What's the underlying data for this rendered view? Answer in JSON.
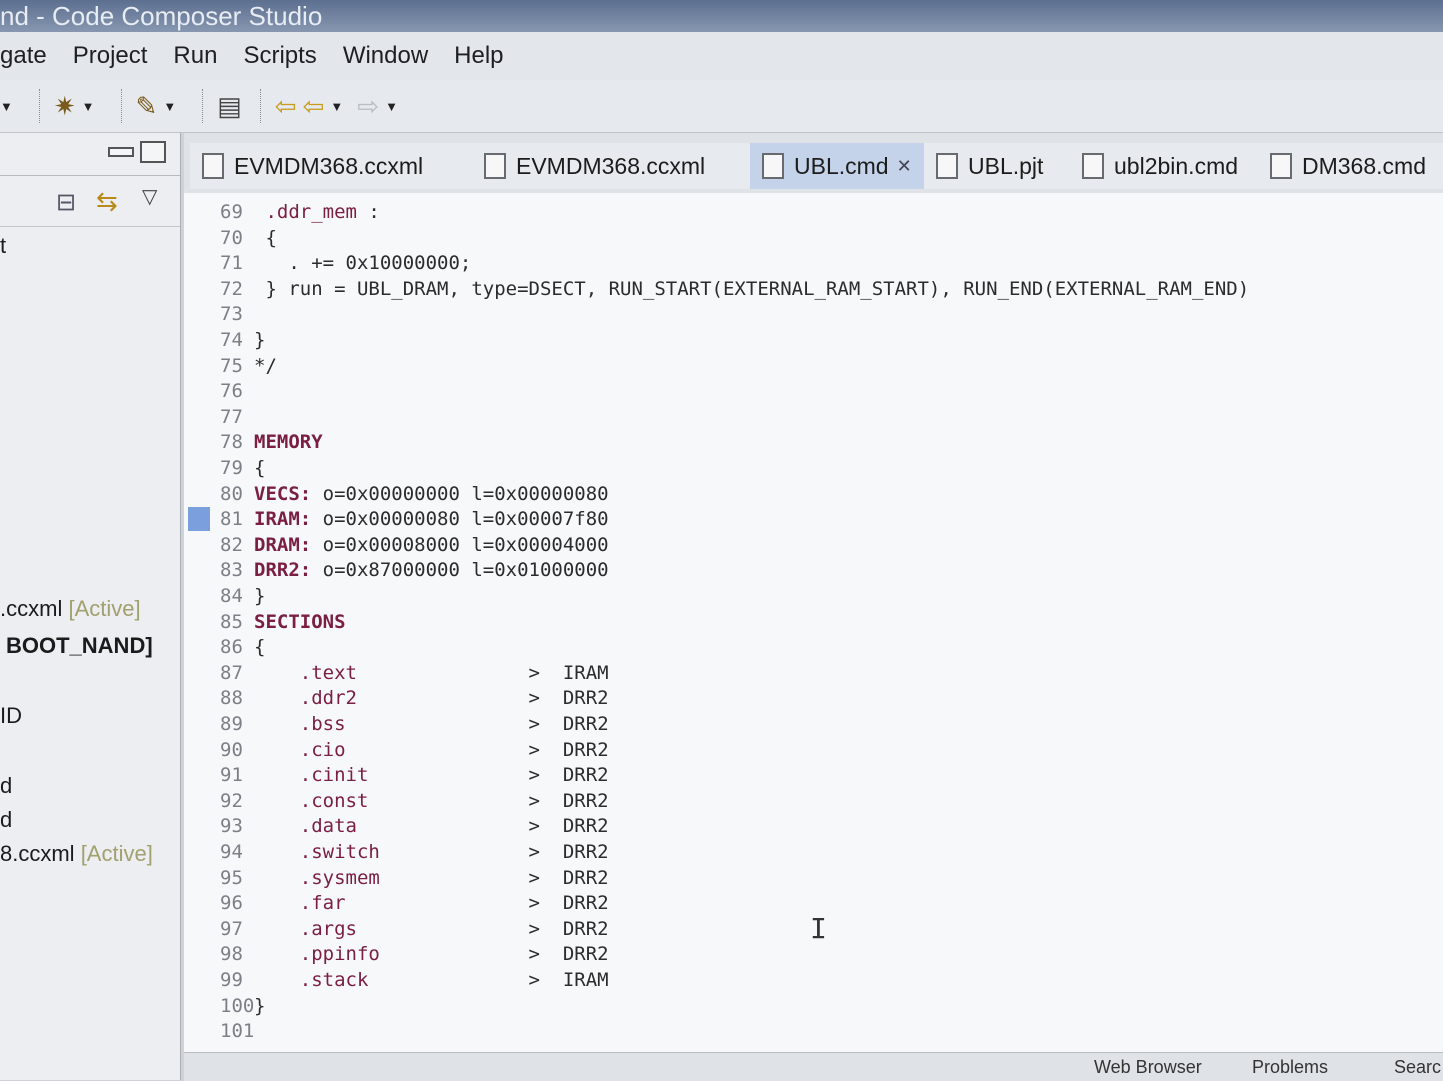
{
  "window": {
    "title": "nd - Code Composer Studio"
  },
  "menu": [
    "gate",
    "Project",
    "Run",
    "Scripts",
    "Window",
    "Help"
  ],
  "left_panel": {
    "items": [
      {
        "text": "t",
        "active": ""
      },
      {
        "text": ".ccxml",
        "active": "[Active]"
      },
      {
        "text": "BOOT_NAND]",
        "active": ""
      },
      {
        "text": "ID",
        "active": ""
      },
      {
        "text": "d",
        "active": ""
      },
      {
        "text": "d",
        "active": ""
      },
      {
        "text": "8.ccxml",
        "active": "[Active]"
      }
    ]
  },
  "tabs": [
    {
      "label": "EVMDM368.ccxml",
      "active": false
    },
    {
      "label": "EVMDM368.ccxml",
      "active": false
    },
    {
      "label": "UBL.cmd",
      "active": true
    },
    {
      "label": "UBL.pjt",
      "active": false
    },
    {
      "label": "ubl2bin.cmd",
      "active": false
    },
    {
      "label": "DM368.cmd",
      "active": false
    }
  ],
  "code_lines": [
    {
      "n": "69",
      "text": " .ddr_mem :"
    },
    {
      "n": "70",
      "text": " {"
    },
    {
      "n": "71",
      "text": "   . += 0x10000000;"
    },
    {
      "n": "72",
      "text": " } run = UBL_DRAM, type=DSECT, RUN_START(EXTERNAL_RAM_START), RUN_END(EXTERNAL_RAM_END)"
    },
    {
      "n": "73",
      "text": ""
    },
    {
      "n": "74",
      "text": "}"
    },
    {
      "n": "75",
      "text": "*/"
    },
    {
      "n": "76",
      "text": ""
    },
    {
      "n": "77",
      "text": ""
    },
    {
      "n": "78",
      "text": "MEMORY"
    },
    {
      "n": "79",
      "text": "{"
    },
    {
      "n": "80",
      "text": "VECS: o=0x00000000 l=0x00000080"
    },
    {
      "n": "81",
      "text": "IRAM: o=0x00000080 l=0x00007f80"
    },
    {
      "n": "82",
      "text": "DRAM: o=0x00008000 l=0x00004000"
    },
    {
      "n": "83",
      "text": "DRR2: o=0x87000000 l=0x01000000"
    },
    {
      "n": "84",
      "text": "}"
    },
    {
      "n": "85",
      "text": "SECTIONS"
    },
    {
      "n": "86",
      "text": "{"
    },
    {
      "n": "87",
      "text": "    .text               >  IRAM"
    },
    {
      "n": "88",
      "text": "    .ddr2               >  DRR2"
    },
    {
      "n": "89",
      "text": "    .bss                >  DRR2"
    },
    {
      "n": "90",
      "text": "    .cio                >  DRR2"
    },
    {
      "n": "91",
      "text": "    .cinit              >  DRR2"
    },
    {
      "n": "92",
      "text": "    .const              >  DRR2"
    },
    {
      "n": "93",
      "text": "    .data               >  DRR2"
    },
    {
      "n": "94",
      "text": "    .switch             >  DRR2"
    },
    {
      "n": "95",
      "text": "    .sysmem             >  DRR2"
    },
    {
      "n": "96",
      "text": "    .far                >  DRR2"
    },
    {
      "n": "97",
      "text": "    .args               >  DRR2"
    },
    {
      "n": "98",
      "text": "    .ppinfo             >  DRR2"
    },
    {
      "n": "99",
      "text": "    .stack              >  IRAM"
    },
    {
      "n": "100",
      "text": "}"
    },
    {
      "n": "101",
      "text": ""
    }
  ],
  "status": {
    "web_browser": "Web Browser",
    "problems": "Problems",
    "search": "Searc"
  }
}
